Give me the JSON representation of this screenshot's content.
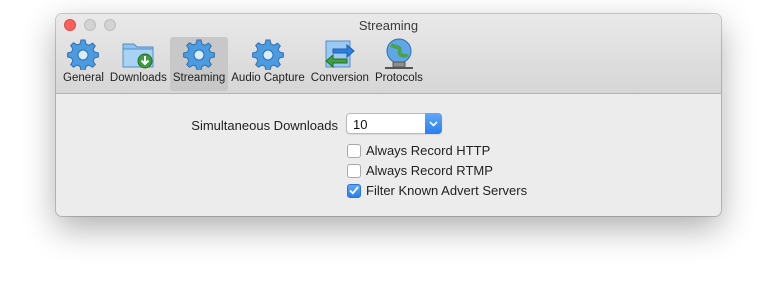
{
  "window": {
    "title": "Streaming"
  },
  "toolbar": {
    "tabs": [
      {
        "label": "General",
        "icon": "gear-icon",
        "active": false
      },
      {
        "label": "Downloads",
        "icon": "downloads-folder-icon",
        "active": false
      },
      {
        "label": "Streaming",
        "icon": "gear-icon",
        "active": true
      },
      {
        "label": "Audio Capture",
        "icon": "gear-icon",
        "active": false
      },
      {
        "label": "Conversion",
        "icon": "conversion-arrows-icon",
        "active": false
      },
      {
        "label": "Protocols",
        "icon": "globe-network-icon",
        "active": false
      }
    ]
  },
  "settings": {
    "simultaneous_label": "Simultaneous Downloads",
    "simultaneous_value": "10",
    "checkboxes": [
      {
        "label": "Always Record HTTP",
        "checked": false
      },
      {
        "label": "Always Record RTMP",
        "checked": false
      },
      {
        "label": "Filter Known Advert Servers",
        "checked": true
      }
    ]
  },
  "colors": {
    "accent": "#2a7ef0",
    "close": "#fc605c",
    "gear": "#4a9be0"
  }
}
